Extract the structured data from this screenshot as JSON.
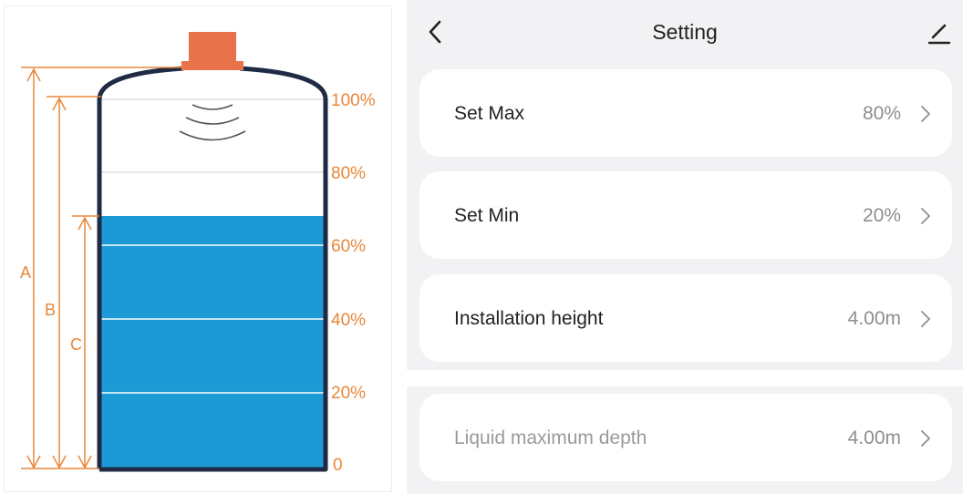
{
  "diagram": {
    "percent_labels": [
      "100%",
      "80%",
      "60%",
      "40%",
      "20%",
      "0"
    ],
    "dimension_letters": [
      "A",
      "B",
      "C"
    ],
    "liquid_level_fraction": 0.68,
    "colors": {
      "accent": "#e8873a",
      "liquid": "#1b9ad6",
      "tank_outline": "#1f2a44",
      "sensor": "#e8734a"
    }
  },
  "header": {
    "title": "Setting",
    "back_icon": "chevron-left-icon",
    "edit_icon": "pencil-icon"
  },
  "settings": {
    "items": [
      {
        "label": "Set Max",
        "value": "80%"
      },
      {
        "label": "Set Min",
        "value": "20%"
      },
      {
        "label": "Installation height",
        "value": "4.00m"
      },
      {
        "label": "Liquid maximum depth",
        "value": "4.00m"
      }
    ]
  }
}
